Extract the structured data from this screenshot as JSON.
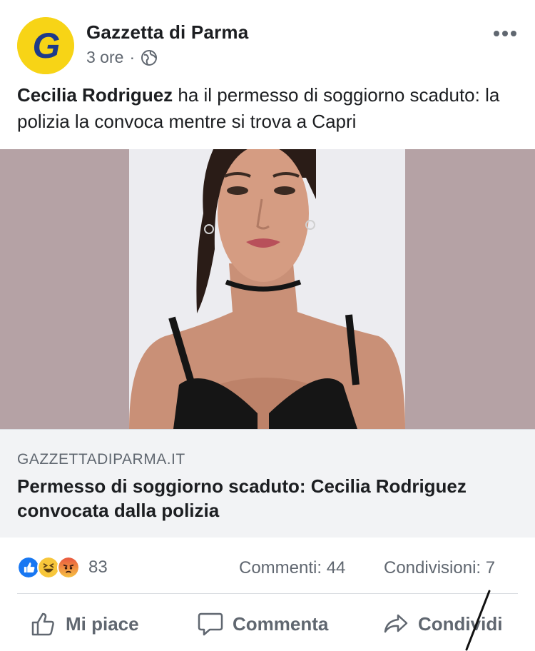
{
  "post": {
    "page_name": "Gazzetta di Parma",
    "timestamp": "3 ore",
    "separator": "·",
    "privacy_icon": "globe-icon",
    "more_icon": "more-options-icon",
    "text_bold": "Cecilia Rodriguez",
    "text_rest": " ha il permesso di soggiorno scaduto: la polizia la convoca mentre si trova a Capri"
  },
  "link": {
    "domain": "GAZZETTADIPARMA.IT",
    "title": "Permesso di soggiorno scaduto: Cecilia Rodriguez convocata dalla polizia"
  },
  "stats": {
    "reaction_icons": [
      "like-reaction-icon",
      "haha-reaction-icon",
      "angry-reaction-icon"
    ],
    "reactions_count": "83",
    "comments": "Commenti: 44",
    "shares": "Condivisioni: 7"
  },
  "actions": {
    "like": "Mi piace",
    "comment": "Commenta",
    "share": "Condividi"
  },
  "colors": {
    "logo_bg": "#f7d416",
    "logo_letter": "#1d3a8a",
    "media_bg": "#b5a2a5",
    "link_bg": "#f2f3f5",
    "like_blue": "#1877f2",
    "muted_text": "#606770"
  }
}
